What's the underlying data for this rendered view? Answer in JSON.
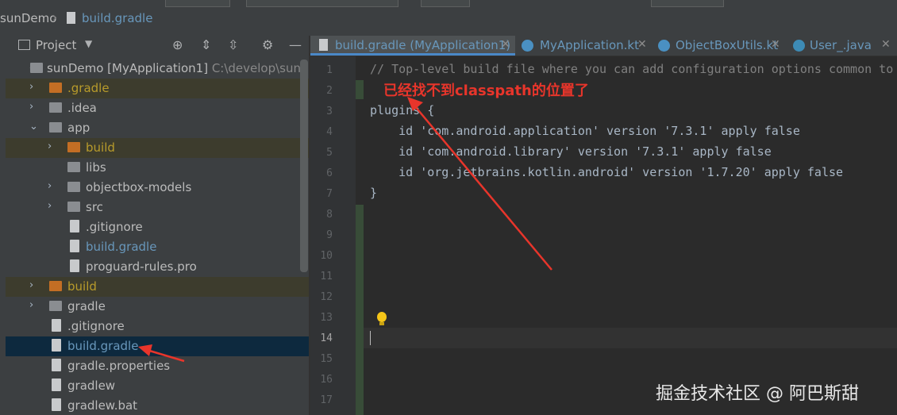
{
  "breadcrumb": {
    "project": "sunDemo",
    "file": "build.gradle"
  },
  "project_panel": {
    "title": "Project"
  },
  "tree": [
    {
      "label": "sunDemo [MyApplication1]",
      "path": "C:\\develop\\sunhaita",
      "expanded": "yes",
      "icon": "module-folder-icon"
    },
    {
      "label": ".gradle",
      "expanded": "no",
      "icon": "folder-icon"
    },
    {
      "label": ".idea",
      "expanded": "no",
      "icon": "folder-icon"
    },
    {
      "label": "app",
      "expanded": "yes",
      "icon": "module-folder-icon"
    },
    {
      "label": "build",
      "expanded": "no",
      "icon": "folder-icon"
    },
    {
      "label": "libs",
      "icon": "folder-icon"
    },
    {
      "label": "objectbox-models",
      "expanded": "no",
      "icon": "folder-icon"
    },
    {
      "label": "src",
      "expanded": "no",
      "icon": "folder-icon"
    },
    {
      "label": ".gitignore",
      "icon": "gitignore-file-icon"
    },
    {
      "label": "build.gradle",
      "icon": "gradle-file-icon"
    },
    {
      "label": "proguard-rules.pro",
      "icon": "text-file-icon"
    },
    {
      "label": "build",
      "expanded": "no",
      "icon": "folder-icon"
    },
    {
      "label": "gradle",
      "expanded": "no",
      "icon": "folder-icon"
    },
    {
      "label": ".gitignore",
      "icon": "gitignore-file-icon"
    },
    {
      "label": "build.gradle",
      "icon": "gradle-file-icon",
      "selected": "yes"
    },
    {
      "label": "gradle.properties",
      "icon": "properties-file-icon"
    },
    {
      "label": "gradlew",
      "icon": "shell-file-icon"
    },
    {
      "label": "gradlew.bat",
      "icon": "bat-file-icon"
    }
  ],
  "tabs": [
    {
      "label": "build.gradle (MyApplication1)",
      "active": "yes"
    },
    {
      "label": "MyApplication.kt"
    },
    {
      "label": "ObjectBoxUtils.kt"
    },
    {
      "label": "User_.java"
    }
  ],
  "editor": {
    "line_numbers": [
      "1",
      "2",
      "3",
      "4",
      "5",
      "6",
      "7",
      "8",
      "9",
      "10",
      "11",
      "12",
      "13",
      "14",
      "15",
      "16",
      "17"
    ],
    "lines": [
      "// Top-level build file where you can add configuration options common to",
      "",
      "plugins {",
      "    id 'com.android.application' version '7.3.1' apply false",
      "    id 'com.android.library' version '7.3.1' apply false",
      "    id 'org.jetbrains.kotlin.android' version '1.7.20' apply false",
      "}"
    ],
    "current_line": "14"
  },
  "annotation": "已经找不到classpath的位置了",
  "watermark": "掘金技术社区 @ 阿巴斯甜",
  "colors": {
    "accent": "#4a88c7",
    "annotation": "#e8352b",
    "selection": "#0d293e"
  }
}
